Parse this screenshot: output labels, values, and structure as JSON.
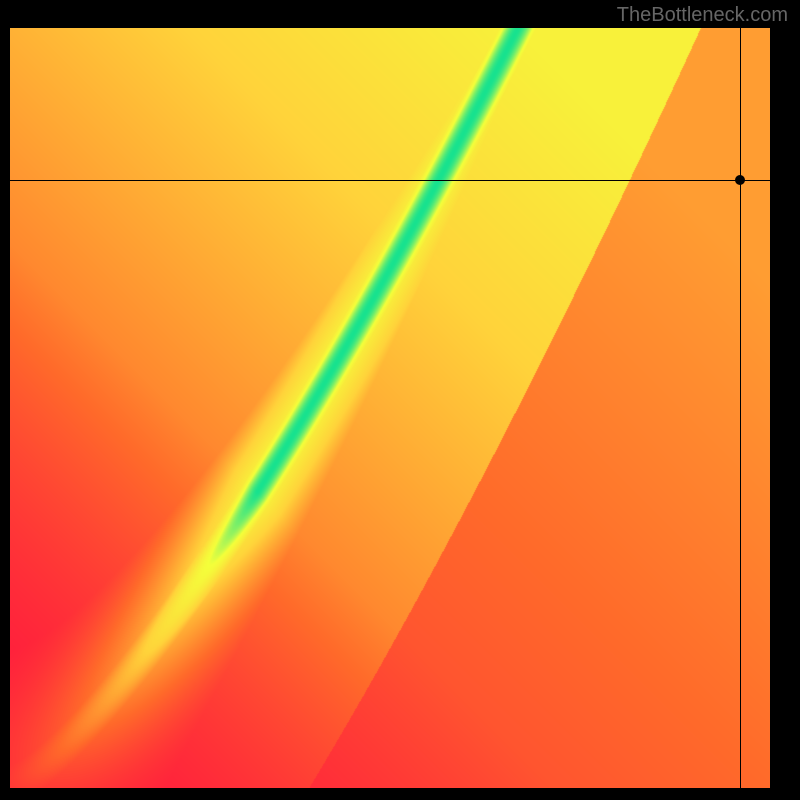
{
  "watermark": "TheBottleneck.com",
  "chart_data": {
    "type": "heatmap",
    "title": "",
    "xlabel": "",
    "ylabel": "",
    "xlim": [
      0,
      100
    ],
    "ylim": [
      0,
      100
    ],
    "marker": {
      "x": 96,
      "y": 80
    },
    "crosshair": {
      "x": 96,
      "y": 80
    },
    "gradient_description": "diagonal performance ridge: green optimal band curves from bottom-left to upper-center; yellow transition; red/orange in off-diagonal corners",
    "color_stops": {
      "worst": "#ff173e",
      "bad": "#ff6a2a",
      "mid": "#ffd33a",
      "near": "#f4ff3a",
      "best": "#17e28f"
    }
  }
}
